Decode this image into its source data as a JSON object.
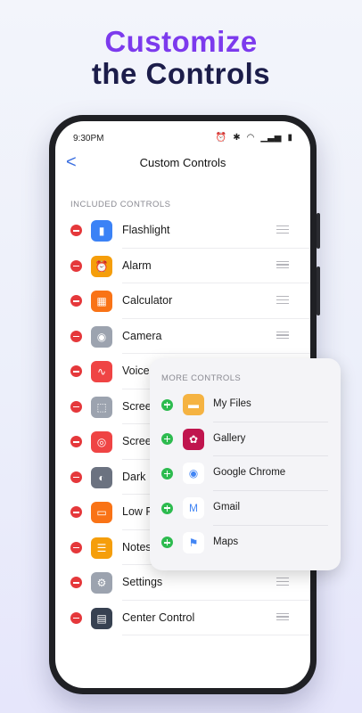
{
  "headline": {
    "line1": "Customize",
    "line2": "the Controls"
  },
  "status_bar": {
    "time": "9:30PM"
  },
  "header": {
    "back": "<",
    "title": "Custom Controls"
  },
  "section_label": "INCLUDED CONTROLS",
  "included": [
    {
      "label": "Flashlight",
      "icon": "flashlight-icon",
      "color": "#3b82f6",
      "glyph": "▮"
    },
    {
      "label": "Alarm",
      "icon": "alarm-icon",
      "color": "#f59e0b",
      "glyph": "⏰"
    },
    {
      "label": "Calculator",
      "icon": "calculator-icon",
      "color": "#f97316",
      "glyph": "▦"
    },
    {
      "label": "Camera",
      "icon": "camera-icon",
      "color": "#9ca3af",
      "glyph": "◉"
    },
    {
      "label": "Voice",
      "icon": "voice-recorder-icon",
      "color": "#ef4444",
      "glyph": "∿"
    },
    {
      "label": "Scree",
      "icon": "screenshot-icon",
      "color": "#9ca3af",
      "glyph": "⬚"
    },
    {
      "label": "Scree",
      "icon": "screen-recorder-icon",
      "color": "#ef4444",
      "glyph": "◎"
    },
    {
      "label": "Dark",
      "icon": "dark-mode-icon",
      "color": "#6b7280",
      "glyph": "◐"
    },
    {
      "label": "Low F",
      "icon": "battery-icon",
      "color": "#f97316",
      "glyph": "▭"
    },
    {
      "label": "Notes",
      "icon": "notes-icon",
      "color": "#f59e0b",
      "glyph": "☰"
    },
    {
      "label": "Settings",
      "icon": "settings-icon",
      "color": "#9ca3af",
      "glyph": "⚙"
    },
    {
      "label": "Center Control",
      "icon": "center-control-icon",
      "color": "#374151",
      "glyph": "▤"
    }
  ],
  "more_controls": {
    "label": "MORE CONTROLS",
    "items": [
      {
        "label": "My Files",
        "icon": "folder-icon",
        "color": "#f5b342",
        "glyph": "▬"
      },
      {
        "label": "Gallery",
        "icon": "gallery-icon",
        "color": "#c0154e",
        "glyph": "✿"
      },
      {
        "label": "Google Chrome",
        "icon": "chrome-icon",
        "color": "#ffffff",
        "glyph": "◉"
      },
      {
        "label": "Gmail",
        "icon": "gmail-icon",
        "color": "#ffffff",
        "glyph": "M"
      },
      {
        "label": "Maps",
        "icon": "maps-icon",
        "color": "#ffffff",
        "glyph": "⚑"
      }
    ]
  }
}
